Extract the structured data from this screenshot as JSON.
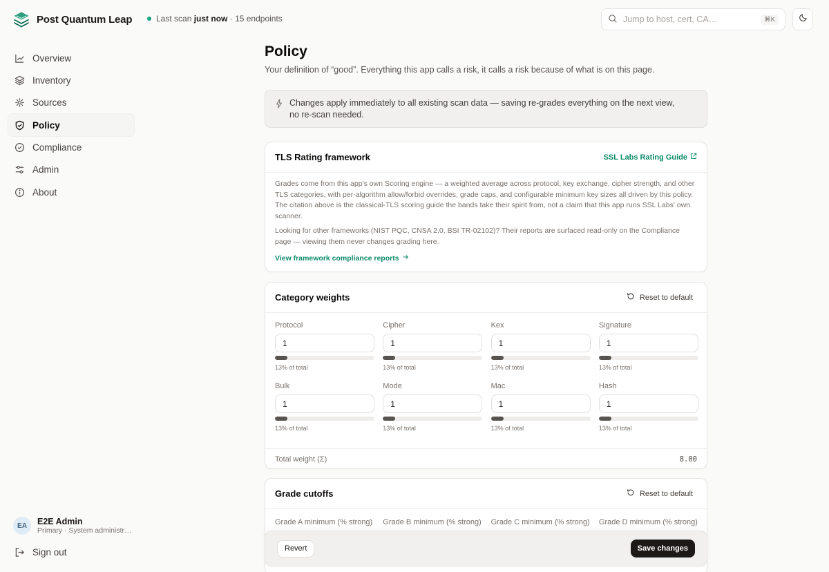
{
  "app": {
    "name": "Post Quantum Leap"
  },
  "status": {
    "prefix": "Last scan",
    "when": "just now",
    "suffix": "· 15 endpoints"
  },
  "search": {
    "placeholder": "Jump to host, cert, CA…",
    "shortcut": "⌘K"
  },
  "sidebar": {
    "items": [
      {
        "label": "Overview",
        "icon": "chart-line-icon"
      },
      {
        "label": "Inventory",
        "icon": "layers-icon"
      },
      {
        "label": "Sources",
        "icon": "satellite-icon"
      },
      {
        "label": "Policy",
        "icon": "shield-check-icon",
        "active": true
      },
      {
        "label": "Compliance",
        "icon": "badge-check-icon"
      },
      {
        "label": "Admin",
        "icon": "sliders-icon"
      },
      {
        "label": "About",
        "icon": "info-icon"
      }
    ]
  },
  "user": {
    "initials": "EA",
    "name": "E2E Admin",
    "role": "Primary · System administrator"
  },
  "signout": {
    "label": "Sign out"
  },
  "page": {
    "title": "Policy",
    "description": "Your definition of “good”. Everything this app calls a risk, it calls a risk because of what is on this page."
  },
  "notice": {
    "text": "Changes apply immediately to all existing scan data — saving re-grades everything on the next view, no re-scan needed."
  },
  "tls": {
    "title": "TLS Rating framework",
    "guide_link": "SSL Labs Rating Guide",
    "para1": "Grades come from this app's own Scoring engine — a weighted average across protocol, key exchange, cipher strength, and other TLS categories, with per-algorithm allow/forbid overrides, grade caps, and configurable minimum key sizes all driven by this policy. The citation above is the classical-TLS scoring guide the bands take their spirit from, not a claim that this app runs SSL Labs' own scanner.",
    "para2": "Looking for other frameworks (NIST PQC, CNSA 2.0, BSI TR-02102)? Their reports are surfaced read-only on the Compliance page — viewing them never changes grading here.",
    "reports_link": "View framework compliance reports"
  },
  "weights": {
    "title": "Category weights",
    "reset": "Reset to default",
    "items": [
      {
        "label": "Protocol",
        "value": "1",
        "pct": "13% of total",
        "fraction": 0.125
      },
      {
        "label": "Cipher",
        "value": "1",
        "pct": "13% of total",
        "fraction": 0.125
      },
      {
        "label": "Kex",
        "value": "1",
        "pct": "13% of total",
        "fraction": 0.125
      },
      {
        "label": "Signature",
        "value": "1",
        "pct": "13% of total",
        "fraction": 0.125
      },
      {
        "label": "Bulk",
        "value": "1",
        "pct": "13% of total",
        "fraction": 0.125
      },
      {
        "label": "Mode",
        "value": "1",
        "pct": "13% of total",
        "fraction": 0.125
      },
      {
        "label": "Mac",
        "value": "1",
        "pct": "13% of total",
        "fraction": 0.125
      },
      {
        "label": "Hash",
        "value": "1",
        "pct": "13% of total",
        "fraction": 0.125
      }
    ],
    "total_label": "Total weight (Σ)",
    "total_value": "8.00"
  },
  "cutoffs": {
    "title": "Grade cutoffs",
    "reset": "Reset to default",
    "labels": [
      "Grade A minimum (% strong)",
      "Grade B minimum (% strong)",
      "Grade C minimum (% strong)",
      "Grade D minimum (% strong)"
    ]
  },
  "actions": {
    "revert": "Revert",
    "save": "Save changes"
  },
  "colors": {
    "accent": "#0d8a6a",
    "status_dot": "#16a37f",
    "primary_button": "#1c1917"
  }
}
